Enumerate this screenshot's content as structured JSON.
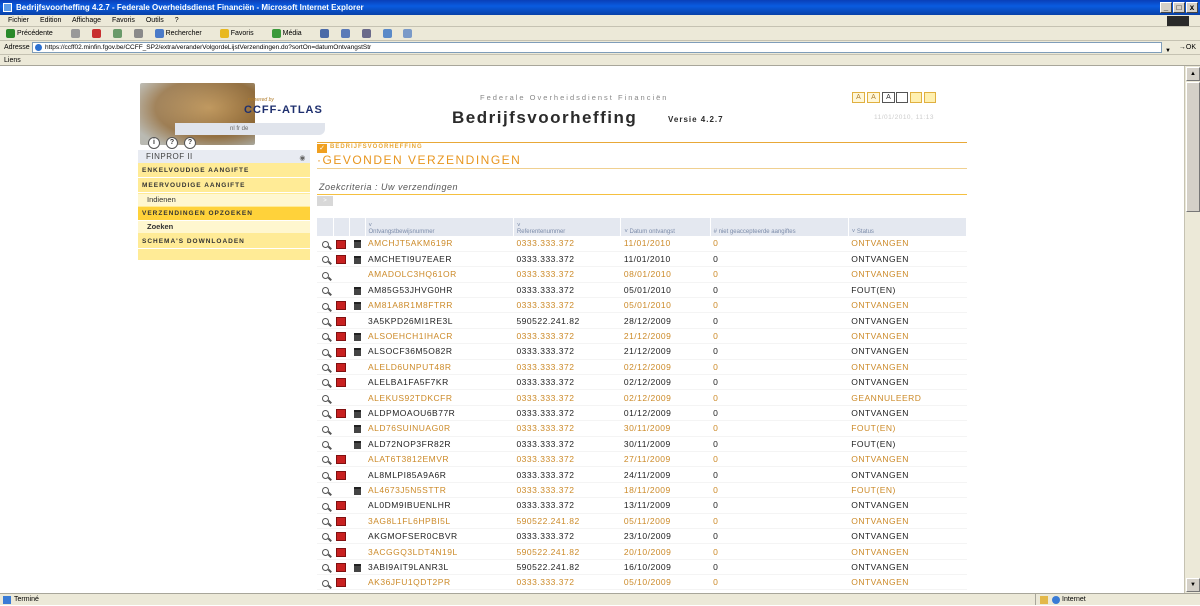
{
  "window": {
    "title": "Bedrijfsvoorheffing 4.2.7 - Federale Overheidsdienst Financiën - Microsoft Internet Explorer",
    "buttons": [
      "_",
      "□",
      "x"
    ]
  },
  "menubar": [
    "Fichier",
    "Edition",
    "Affichage",
    "Favoris",
    "Outils",
    "?"
  ],
  "toolbar": {
    "back": "Précédente",
    "search": "Rechercher",
    "favorites": "Favoris",
    "media": "Média"
  },
  "address": {
    "label": "Adresse",
    "url": "https://ccff02.minfin.fgov.be/CCFF_SP2/extra/veranderVolgordeLijstVerzendingen.do?sortOn=datumOntvangstStr",
    "go": "OK"
  },
  "links_label": "Liens",
  "status": {
    "text": "Terminé",
    "zone": "Internet"
  },
  "header": {
    "powered_by": "powered by",
    "atlas_logo": "CCFF-ATLAS",
    "lang": "nl  fr  de",
    "fed_title": "Federale Overheidsdienst Financiën",
    "app_title": "Bedrijfsvoorheffing",
    "app_version": "Versie 4.2.7",
    "datetime": "11/01/2010, 11:13",
    "font_sizes": [
      "A",
      "A",
      "A"
    ]
  },
  "nav": {
    "icons": [
      "i",
      "?",
      "?"
    ],
    "user": "FINPROF II",
    "items": [
      {
        "label": "ENKELVOUDIGE AANGIFTE"
      },
      {
        "label": "MEERVOUDIGE AANGIFTE",
        "sub": "Indienen"
      },
      {
        "label": "VERZENDINGEN OPZOEKEN",
        "sub": "Zoeken"
      },
      {
        "label": "SCHEMA'S DOWNLOADEN"
      }
    ]
  },
  "main": {
    "section_tab": "BEDRIJFSVOORHEFFING",
    "page_title": "·GEVONDEN VERZENDINGEN",
    "criteria": "Zoekcriteria : Uw verzendingen",
    "columns": [
      "Ontvangstbewijsnummer",
      "Referentenummer",
      "Datum ontvangst",
      "# niet geaccepteerde aangiftes",
      "Status"
    ],
    "rows": [
      {
        "id": "AMCHJT5AKM619R",
        "ref": "0333.333.372",
        "date": "11/01/2010",
        "count": "0",
        "status": "ONTVANGEN",
        "pdf": true,
        "trash": true
      },
      {
        "id": "AMCHETI9U7EAER",
        "ref": "0333.333.372",
        "date": "11/01/2010",
        "count": "0",
        "status": "ONTVANGEN",
        "pdf": true,
        "trash": true
      },
      {
        "id": "AMADOLC3HQ61OR",
        "ref": "0333.333.372",
        "date": "08/01/2010",
        "count": "0",
        "status": "ONTVANGEN",
        "pdf": false,
        "trash": false
      },
      {
        "id": "AM85G53JHVG0HR",
        "ref": "0333.333.372",
        "date": "05/01/2010",
        "count": "0",
        "status": "FOUT(EN)",
        "pdf": false,
        "trash": true
      },
      {
        "id": "AM81A8R1M8FTRR",
        "ref": "0333.333.372",
        "date": "05/01/2010",
        "count": "0",
        "status": "ONTVANGEN",
        "pdf": true,
        "trash": true
      },
      {
        "id": "3A5KPD26MI1RE3L",
        "ref": "590522.241.82",
        "date": "28/12/2009",
        "count": "0",
        "status": "ONTVANGEN",
        "pdf": true,
        "trash": false
      },
      {
        "id": "ALSOEHCH1IHACR",
        "ref": "0333.333.372",
        "date": "21/12/2009",
        "count": "0",
        "status": "ONTVANGEN",
        "pdf": true,
        "trash": true
      },
      {
        "id": "ALSOCF36M5O82R",
        "ref": "0333.333.372",
        "date": "21/12/2009",
        "count": "0",
        "status": "ONTVANGEN",
        "pdf": true,
        "trash": true
      },
      {
        "id": "ALELD6UNPUT48R",
        "ref": "0333.333.372",
        "date": "02/12/2009",
        "count": "0",
        "status": "ONTVANGEN",
        "pdf": true,
        "trash": false
      },
      {
        "id": "ALELBA1FA5F7KR",
        "ref": "0333.333.372",
        "date": "02/12/2009",
        "count": "0",
        "status": "ONTVANGEN",
        "pdf": true,
        "trash": false
      },
      {
        "id": "ALEKUS92TDKCFR",
        "ref": "0333.333.372",
        "date": "02/12/2009",
        "count": "0",
        "status": "GEANNULEERD",
        "pdf": false,
        "trash": false
      },
      {
        "id": "ALDPMOAOU6B77R",
        "ref": "0333.333.372",
        "date": "01/12/2009",
        "count": "0",
        "status": "ONTVANGEN",
        "pdf": true,
        "trash": true
      },
      {
        "id": "ALD76SUINUAG0R",
        "ref": "0333.333.372",
        "date": "30/11/2009",
        "count": "0",
        "status": "FOUT(EN)",
        "pdf": false,
        "trash": true
      },
      {
        "id": "ALD72NOP3FR82R",
        "ref": "0333.333.372",
        "date": "30/11/2009",
        "count": "0",
        "status": "FOUT(EN)",
        "pdf": false,
        "trash": true
      },
      {
        "id": "ALAT6T3812EMVR",
        "ref": "0333.333.372",
        "date": "27/11/2009",
        "count": "0",
        "status": "ONTVANGEN",
        "pdf": true,
        "trash": false
      },
      {
        "id": "AL8MLPI85A9A6R",
        "ref": "0333.333.372",
        "date": "24/11/2009",
        "count": "0",
        "status": "ONTVANGEN",
        "pdf": true,
        "trash": false
      },
      {
        "id": "AL4673J5N5STTR",
        "ref": "0333.333.372",
        "date": "18/11/2009",
        "count": "0",
        "status": "FOUT(EN)",
        "pdf": false,
        "trash": true
      },
      {
        "id": "AL0DM9IBUENLHR",
        "ref": "0333.333.372",
        "date": "13/11/2009",
        "count": "0",
        "status": "ONTVANGEN",
        "pdf": true,
        "trash": false
      },
      {
        "id": "3AG8L1FL6HPBI5L",
        "ref": "590522.241.82",
        "date": "05/11/2009",
        "count": "0",
        "status": "ONTVANGEN",
        "pdf": true,
        "trash": false
      },
      {
        "id": "AKGMOFSER0CBVR",
        "ref": "0333.333.372",
        "date": "23/10/2009",
        "count": "0",
        "status": "ONTVANGEN",
        "pdf": true,
        "trash": false
      },
      {
        "id": "3ACGGQ3LDT4N19L",
        "ref": "590522.241.82",
        "date": "20/10/2009",
        "count": "0",
        "status": "ONTVANGEN",
        "pdf": true,
        "trash": false
      },
      {
        "id": "3ABI9AIT9LANR3L",
        "ref": "590522.241.82",
        "date": "16/10/2009",
        "count": "0",
        "status": "ONTVANGEN",
        "pdf": true,
        "trash": true
      },
      {
        "id": "AK36JFU1QDT2PR",
        "ref": "0333.333.372",
        "date": "05/10/2009",
        "count": "0",
        "status": "ONTVANGEN",
        "pdf": true,
        "trash": false
      }
    ]
  }
}
